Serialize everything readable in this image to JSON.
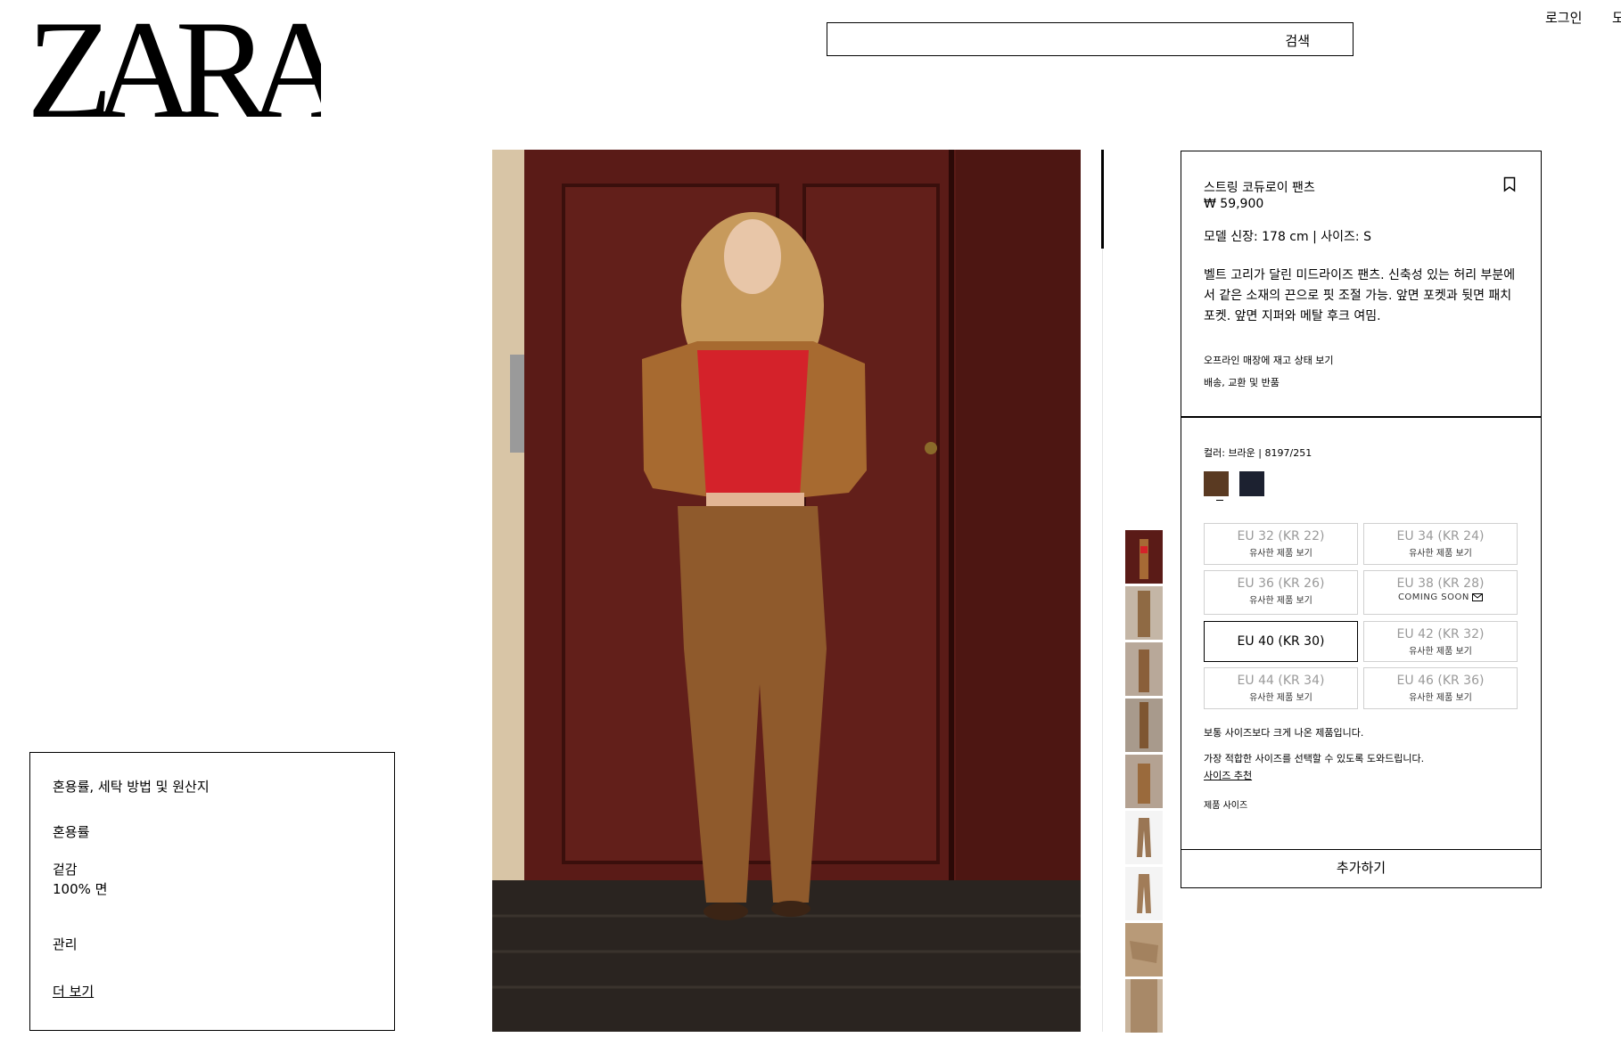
{
  "brand": {
    "name": "ZARA"
  },
  "header": {
    "search_label": "검색",
    "login_label": "로그인",
    "overflow_label": "도"
  },
  "product": {
    "name": "스트링 코듀로이 팬츠",
    "price": "₩ 59,900",
    "model_info": "모델 신장: 178 cm | 사이즈: S",
    "description": "벨트 고리가 달린 미드라이즈 팬츠. 신축성 있는 허리 부분에서 같은 소재의 끈으로 핏 조절 가능. 앞면 포켓과 뒷면 패치 포켓. 앞면 지퍼와 메탈 후크 여밈.",
    "store_stock_link": "오프라인 매장에 재고 상태 보기",
    "shipping_link": "배송, 교환 및 반품",
    "color_label": "컬러: 브라운 | 8197/251",
    "colors": [
      {
        "name": "brown",
        "hex": "#5a3a22",
        "selected": true
      },
      {
        "name": "navy",
        "hex": "#1c2130",
        "selected": false
      }
    ],
    "sizes": [
      {
        "label": "EU 32 (KR 22)",
        "sub": "유사한 제품 보기",
        "selected": false
      },
      {
        "label": "EU 34 (KR 24)",
        "sub": "유사한 제품 보기",
        "selected": false
      },
      {
        "label": "EU 36 (KR 26)",
        "sub": "유사한 제품 보기",
        "selected": false
      },
      {
        "label": "EU 38 (KR 28)",
        "sub": "COMING SOON",
        "selected": false
      },
      {
        "label": "EU 40 (KR 30)",
        "sub": "",
        "selected": true
      },
      {
        "label": "EU 42 (KR 32)",
        "sub": "유사한 제품 보기",
        "selected": false
      },
      {
        "label": "EU 44 (KR 34)",
        "sub": "유사한 제품 보기",
        "selected": false
      },
      {
        "label": "EU 46 (KR 36)",
        "sub": "유사한 제품 보기",
        "selected": false
      }
    ],
    "fit_note": "보통 사이즈보다 크게 나온 제품입니다.",
    "size_help": "가장 적합한 사이즈를 선택할 수 있도록 도와드립니다.",
    "size_recommend_link": "사이즈 추천",
    "product_size_link": "제품 사이즈",
    "add_button": "추가하기"
  },
  "composition": {
    "title": "혼용률, 세탁 방법 및 원산지",
    "section": "혼용률",
    "outer_label": "겉감",
    "outer_value": "100% 면",
    "care_label": "관리",
    "more_link": "더 보기"
  }
}
